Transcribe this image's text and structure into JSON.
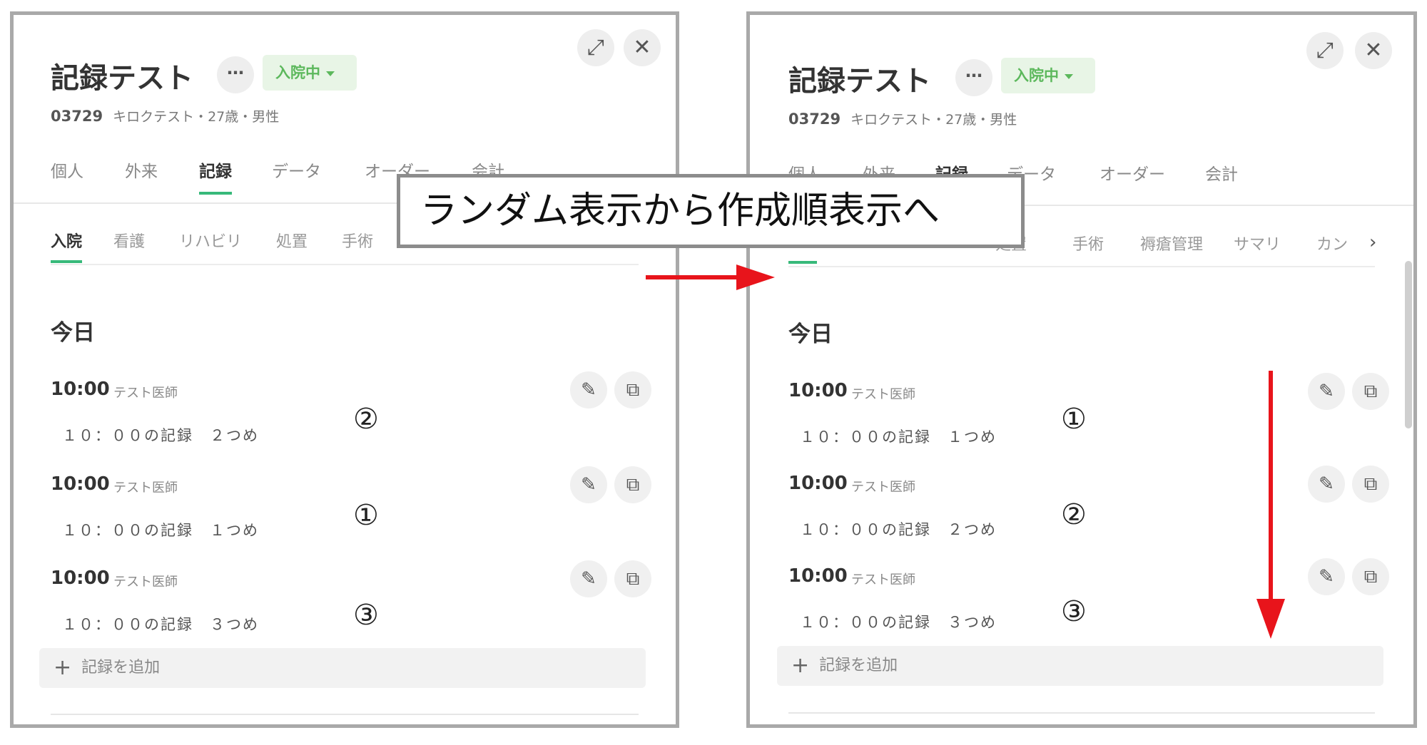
{
  "panels": {
    "left": {
      "title": "記録テスト",
      "more": "⋯",
      "status": "入院中",
      "patient_id": "03729",
      "patient_info": "キロクテスト・27歳・男性",
      "tabs": [
        "個人",
        "外来",
        "記録",
        "データ",
        "オーダー",
        "会計"
      ],
      "active_tab": "記録",
      "subtabs": [
        "入院",
        "看護",
        "リハビリ",
        "処置",
        "手術"
      ],
      "active_subtab": "入院",
      "section": "今日",
      "records": [
        {
          "time": "10:00",
          "doctor": "テスト医師",
          "body": "１０：００の記録　２つめ",
          "order": "②"
        },
        {
          "time": "10:00",
          "doctor": "テスト医師",
          "body": "１０：００の記録　１つめ",
          "order": "①"
        },
        {
          "time": "10:00",
          "doctor": "テスト医師",
          "body": "１０：００の記録　３つめ",
          "order": "③"
        }
      ],
      "add_label": "記録を追加"
    },
    "right": {
      "title": "記録テスト",
      "more": "⋯",
      "status": "入院中",
      "patient_id": "03729",
      "patient_info": "キロクテスト・27歳・男性",
      "tabs": [
        "個人",
        "外来",
        "記録",
        "データ",
        "オーダー",
        "会計"
      ],
      "active_tab": "記録",
      "subtabs": [
        "処置",
        "手術",
        "褥瘡管理",
        "サマリ",
        "カン"
      ],
      "section": "今日",
      "records": [
        {
          "time": "10:00",
          "doctor": "テスト医師",
          "body": "１０：００の記録　１つめ",
          "order": "①"
        },
        {
          "time": "10:00",
          "doctor": "テスト医師",
          "body": "１０：００の記録　２つめ",
          "order": "②"
        },
        {
          "time": "10:00",
          "doctor": "テスト医師",
          "body": "１０：００の記録　３つめ",
          "order": "③"
        }
      ],
      "add_label": "記録を追加"
    }
  },
  "caption": "ランダム表示から作成順表示へ",
  "colors": {
    "accent_green": "#37b97a",
    "status_green": "#5cb85c",
    "arrow_red": "#e8141b",
    "frame_gray": "#a9a9a9"
  },
  "icons": {
    "expand": "expand-icon",
    "close": "close-icon",
    "edit": "pencil-icon",
    "copy": "copy-icon",
    "add": "plus-icon",
    "next": "chevron-right-icon"
  }
}
